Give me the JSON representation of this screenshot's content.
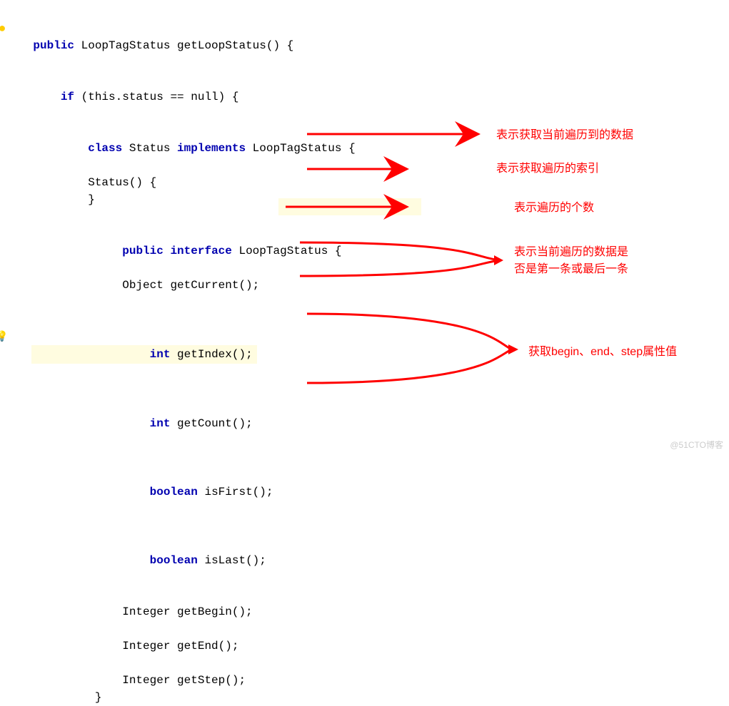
{
  "code": {
    "l1_public": "public",
    "l1_rest": " LoopTagStatus getLoopStatus() {",
    "l2_if": "    if",
    "l2_rest": " (this.status == null) {",
    "l3_class": "        class",
    "l3_mid": " Status ",
    "l3_impl": "implements",
    "l3_rest": " LoopTagStatus {",
    "l4": "            Status() {",
    "l5": "            }",
    "l7_pad": "             ",
    "l7_public": "public",
    "l7_sp": " ",
    "l7_interface": "interface",
    "l7_rest": " LoopTagStatus {",
    "l8": "                 Object getCurrent();",
    "l10_pad": "                 ",
    "l10_int": "int",
    "l10_rest": " getIndex();",
    "l12_pad": "                 ",
    "l12_int": "int",
    "l12_rest": " getCount();",
    "l14_pad": "                 ",
    "l14_bool": "boolean",
    "l14_rest": " isFirst();",
    "l16_pad": "                 ",
    "l16_bool": "boolean",
    "l16_rest": " isLast();",
    "l18": "                 Integer getBegin();",
    "l20": "                 Integer getEnd();",
    "l22": "                 Integer getStep();",
    "l23": "             }"
  },
  "annotations": {
    "a1": "表示获取当前遍历到的数据",
    "a2": "表示获取遍历的索引",
    "a3": "表示遍历的个数",
    "a4_l1": "表示当前遍历的数据是",
    "a4_l2": "否是第一条或最后一条",
    "a5": "获取begin、end、step属性值"
  },
  "icons": {
    "bulb": "lightbulb-icon",
    "dot": "warning-dot-icon"
  },
  "watermark": "@51CTO博客"
}
